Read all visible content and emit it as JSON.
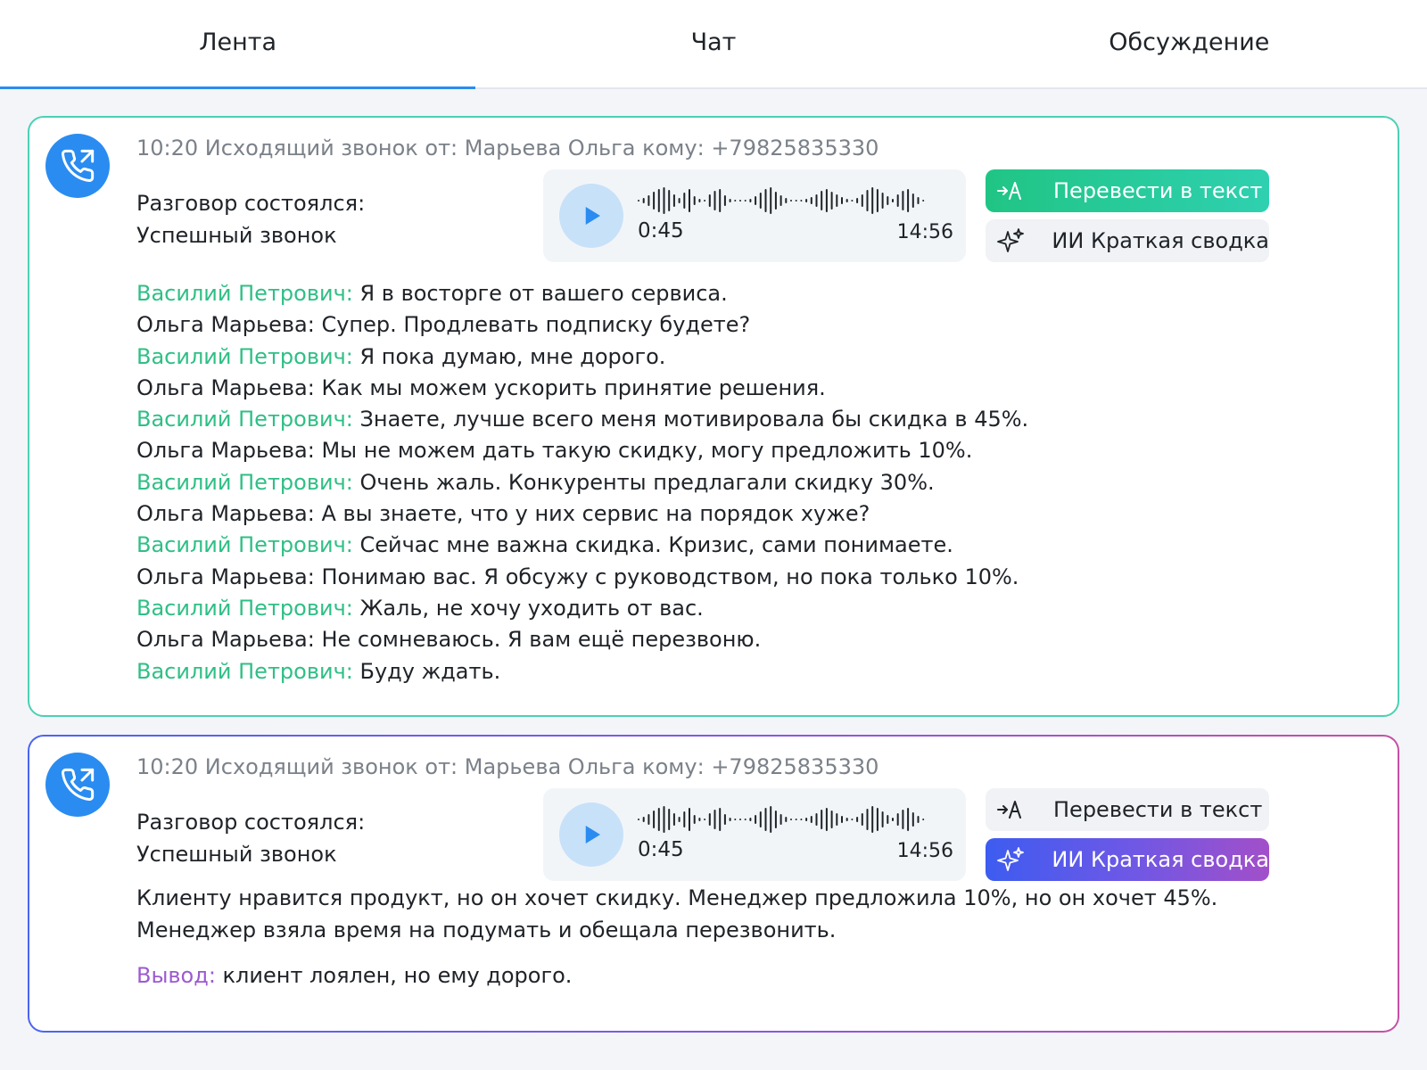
{
  "tabs": [
    {
      "label": "Лента",
      "active": true
    },
    {
      "label": "Чат",
      "active": false
    },
    {
      "label": "Обсуждение",
      "active": false
    }
  ],
  "colors": {
    "accent": "#2a8cf0",
    "card1_border": "#4cd0b4",
    "client_speaker": "#2fbf86",
    "conclusion_label": "#9b5bd0"
  },
  "cards": [
    {
      "meta": "10:20 Исходящий звонок от: Марьева Ольга кому: +79825835330",
      "status_line1": "Разговор состоялся:",
      "status_line2": "Успешный звонок",
      "player": {
        "current": "0:45",
        "total": "14:56"
      },
      "btn_transcribe": "Перевести в текст",
      "btn_summary": "ИИ Краткая сводка",
      "transcript": [
        {
          "speaker": "Василий Петрович:",
          "text": " Я в восторге от вашего сервиса."
        },
        {
          "speaker": "Ольга Марьева:",
          "text": " Супер. Продлевать подписку будете?"
        },
        {
          "speaker": "Василий Петрович:",
          "text": " Я пока думаю, мне дорого."
        },
        {
          "speaker": "Ольга Марьева:",
          "text": " Как мы можем ускорить принятие решения."
        },
        {
          "speaker": "Василий Петрович:",
          "text": " Знаете, лучше всего меня мотивировала бы скидка в 45%."
        },
        {
          "speaker": "Ольга Марьева:",
          "text": " Мы не можем дать такую скидку, могу предложить 10%."
        },
        {
          "speaker": "Василий Петрович:",
          "text": " Очень жаль. Конкуренты предлагали скидку 30%."
        },
        {
          "speaker": "Ольга Марьева:",
          "text": " А вы знаете, что у них сервис на порядок хуже?"
        },
        {
          "speaker": "Василий Петрович:",
          "text": " Сейчас мне важна скидка. Кризис, сами понимаете."
        },
        {
          "speaker": "Ольга Марьева:",
          "text": " Понимаю вас. Я обсужу с руководством, но пока только 10%."
        },
        {
          "speaker": "Василий Петрович:",
          "text": " Жаль, не хочу уходить от вас."
        },
        {
          "speaker": "Ольга Марьева:",
          "text": " Не сомневаюсь. Я вам ещё перезвоню."
        },
        {
          "speaker": "Василий Петрович:",
          "text": " Буду ждать."
        }
      ]
    },
    {
      "meta": "10:20 Исходящий звонок от: Марьева Ольга кому: +79825835330",
      "status_line1": "Разговор состоялся:",
      "status_line2": "Успешный звонок",
      "player": {
        "current": "0:45",
        "total": "14:56"
      },
      "btn_transcribe": "Перевести в текст",
      "btn_summary": "ИИ Краткая сводка",
      "summary_line1": "Клиенту нравится продукт, но он хочет скидку. Менеджер предложила 10%, но он хочет 45%.",
      "summary_line2": "Менеджер взяла время на подумать и обещала перезвонить.",
      "conclusion_label": "Вывод:",
      "conclusion_text": " клиент лоялен, но ему дорого."
    }
  ]
}
